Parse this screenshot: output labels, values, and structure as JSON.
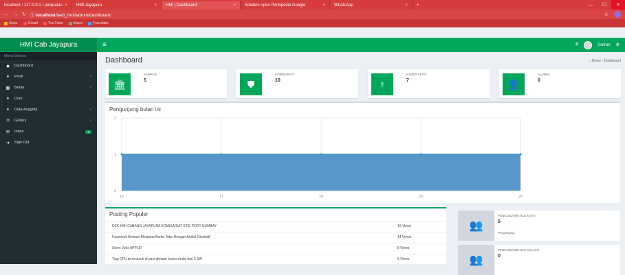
{
  "browser": {
    "tabs": [
      {
        "label": "localhost / 127.0.0.1 / penjualan",
        "active": false
      },
      {
        "label": "HMI Jayapura",
        "active": false
      },
      {
        "label": "HMI | Dashboard",
        "active": true
      },
      {
        "label": "Solution open Portopedia Google",
        "active": false
      },
      {
        "label": "WhatsApp",
        "active": false
      }
    ],
    "url_host": "localhost",
    "url_path": "/web_hmi/admin/dashboard",
    "bookmarks": [
      "Apps",
      "Gmail",
      "YouTube",
      "Maps",
      "Translate"
    ]
  },
  "app": {
    "logo": "HMI Cab Jayapura",
    "user_name": "Gufran",
    "menu_header": "Menu Utama",
    "menu": [
      {
        "label": "Dashboard",
        "icon": "dashboard-icon",
        "glyph": "◆",
        "caret": false,
        "badge": ""
      },
      {
        "label": "Profil",
        "icon": "users-icon",
        "glyph": "♦",
        "caret": true,
        "badge": ""
      },
      {
        "label": "Berita",
        "icon": "news-icon",
        "glyph": "▦",
        "caret": true,
        "badge": ""
      },
      {
        "label": "User",
        "icon": "user-icon",
        "glyph": "♦",
        "caret": false,
        "badge": ""
      },
      {
        "label": "Data Anggota",
        "icon": "members-icon",
        "glyph": "♦",
        "caret": true,
        "badge": ""
      },
      {
        "label": "Gallery",
        "icon": "camera-icon",
        "glyph": "◘",
        "caret": true,
        "badge": ""
      },
      {
        "label": "Inbox",
        "icon": "envelope-icon",
        "glyph": "✉",
        "caret": false,
        "badge": "1"
      },
      {
        "label": "Sign Out",
        "icon": "signout-icon",
        "glyph": "➜",
        "caret": false,
        "badge": ""
      }
    ]
  },
  "page": {
    "title": "Dashboard",
    "breadcrumb_home": "Home",
    "breadcrumb_current": "Dashboard"
  },
  "info_boxes": [
    {
      "label": "KAMPUS",
      "value": "5",
      "icon": "bank-icon",
      "glyph": "🏛"
    },
    {
      "label": "KOMISARIAT",
      "value": "10",
      "icon": "shield-icon",
      "glyph": "⛊"
    },
    {
      "label": "KADER AKTIF",
      "value": "7",
      "icon": "child-icon",
      "glyph": "♀"
    },
    {
      "label": "ALUMNI",
      "value": "0",
      "icon": "user-icon",
      "glyph": "👤"
    }
  ],
  "chart_data": {
    "type": "area",
    "title": "Pengunjung bulan ini",
    "x": [
      "16",
      "17",
      "24",
      "25",
      "26"
    ],
    "values": [
      1,
      1,
      1,
      1,
      1
    ],
    "ylim": [
      0,
      2
    ],
    "yticks": [
      "0",
      "1",
      "2"
    ],
    "color": "#4e91c6",
    "grid": true
  },
  "posting": {
    "title": "Posting Populer",
    "rows": [
      {
        "title": "DEK HMI CABANG JAYAPURA KOMISARIAT STIE PORT NUMBAY",
        "views": "16 Views"
      },
      {
        "title": "Facebook Bekuan Melawan Berita Tobe Dengan Artikel Otoritatif",
        "views": "14 Views"
      },
      {
        "title": "Steve Jobs APPLE!",
        "views": "8 Views"
      },
      {
        "title": "Tiap CPU teromusuk di pasi dimaan buses mulai dari 5 SAI",
        "views": "5 Views"
      }
    ]
  },
  "stats": [
    {
      "label": "PENGUNJUNG BULAN INI",
      "value": "5",
      "sub": "Pengunjung",
      "icon": "users-icon"
    },
    {
      "label": "PENGUNJUNG BULAN LALU",
      "value": "0",
      "sub": "",
      "icon": "users-icon"
    }
  ]
}
